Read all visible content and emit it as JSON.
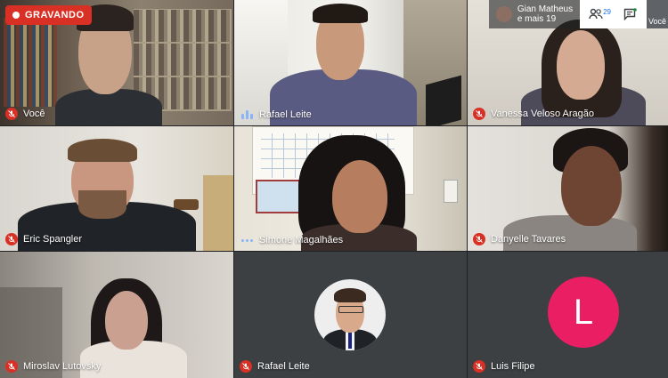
{
  "recording": {
    "label": "GRAVANDO"
  },
  "presenter": {
    "line1": "Gian Matheus",
    "line2": "e mais 19"
  },
  "participants_count": "29",
  "self_caption": "Você",
  "tiles": [
    {
      "name": "Você",
      "mic": "muted"
    },
    {
      "name": "Rafael Leite",
      "mic": "speaking"
    },
    {
      "name": "Vanessa Veloso Aragão",
      "mic": "muted"
    },
    {
      "name": "Eric Spangler",
      "mic": "muted"
    },
    {
      "name": "Simone Magalhães",
      "mic": "active"
    },
    {
      "name": "Danyelle Tavares",
      "mic": "muted"
    },
    {
      "name": "Miroslav Lutovsky",
      "mic": "muted"
    },
    {
      "name": "Rafael Leite",
      "mic": "muted"
    },
    {
      "name": "Luis Filipe",
      "mic": "muted",
      "avatar_letter": "L"
    }
  ],
  "colors": {
    "muted": "#d93025",
    "accent": "#1a73e8",
    "avatar_l": "#e91e63"
  }
}
